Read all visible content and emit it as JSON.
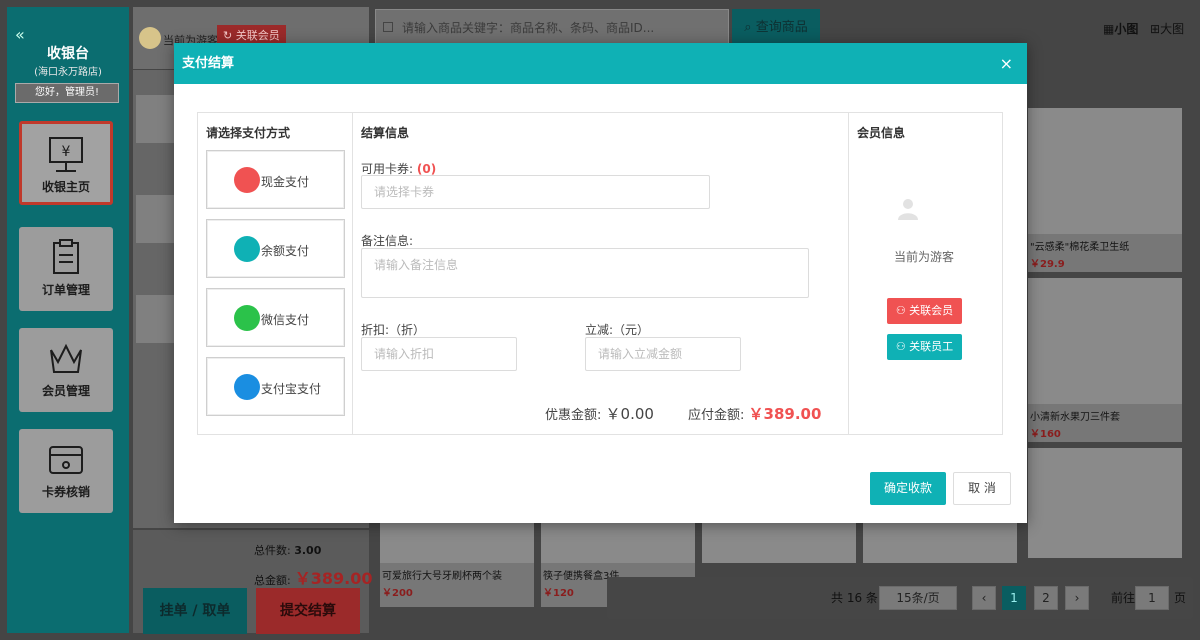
{
  "sidebar": {
    "title": "收银台",
    "store": "(海口永万路店)",
    "greeting": "您好，管理员!",
    "items": [
      {
        "label": "收银主页"
      },
      {
        "label": "订单管理"
      },
      {
        "label": "会员管理"
      },
      {
        "label": "卡券核销"
      }
    ]
  },
  "topbar": {
    "guest_label": "当前为游客",
    "link_member": "关联会员",
    "search_placeholder": "请输入商品关键字：商品名称、条码、商品ID...",
    "query_button": "查询商品",
    "view_small": "小图",
    "view_big": "大图"
  },
  "summary": {
    "total_count_label": "总件数:",
    "total_count": "3.00",
    "total_amount_label": "总金额:",
    "total_amount": "￥389.00",
    "hang_button": "挂单 / 取单",
    "submit_button": "提交结算"
  },
  "products": [
    {
      "name": "\"云感柔\"棉花柔卫生纸",
      "price": "￥29.9"
    },
    {
      "name": "小清新水果刀三件套",
      "price": "￥160"
    },
    {
      "name": "可爱旅行大号牙刷杯两个装",
      "price": "￥200"
    },
    {
      "name": "筷子便携餐盒3件",
      "price": "￥120"
    }
  ],
  "pagination": {
    "total": "共 16 条",
    "per_page": "15条/页",
    "pages": [
      "1",
      "2"
    ],
    "goto_label": "前往",
    "goto_value": "1",
    "page_suffix": "页"
  },
  "modal": {
    "title": "支付结算",
    "close": "×",
    "pay_section_title": "请选择支付方式",
    "pay_methods": [
      {
        "label": "现金支付",
        "color": "#f05252"
      },
      {
        "label": "余额支付",
        "color": "#0fb1b5"
      },
      {
        "label": "微信支付",
        "color": "#2bc24a"
      },
      {
        "label": "支付宝支付",
        "color": "#1a8ee1"
      }
    ],
    "settle_section_title": "结算信息",
    "coupon_label": "可用卡券:",
    "coupon_count": "(0)",
    "coupon_placeholder": "请选择卡券",
    "remark_label": "备注信息:",
    "remark_placeholder": "请输入备注信息",
    "discount_label": "折扣:（折）",
    "discount_placeholder": "请输入折扣",
    "reduce_label": "立减:（元）",
    "reduce_placeholder": "请输入立减金额",
    "discount_amount_label": "优惠金额:",
    "discount_amount": "￥0.00",
    "payable_label": "应付金额:",
    "payable_amount": "￥389.00",
    "member_section_title": "会员信息",
    "member_guest": "当前为游客",
    "link_member_button": "关联会员",
    "link_staff_button": "关联员工",
    "confirm_button": "确定收款",
    "cancel_button": "取 消"
  }
}
